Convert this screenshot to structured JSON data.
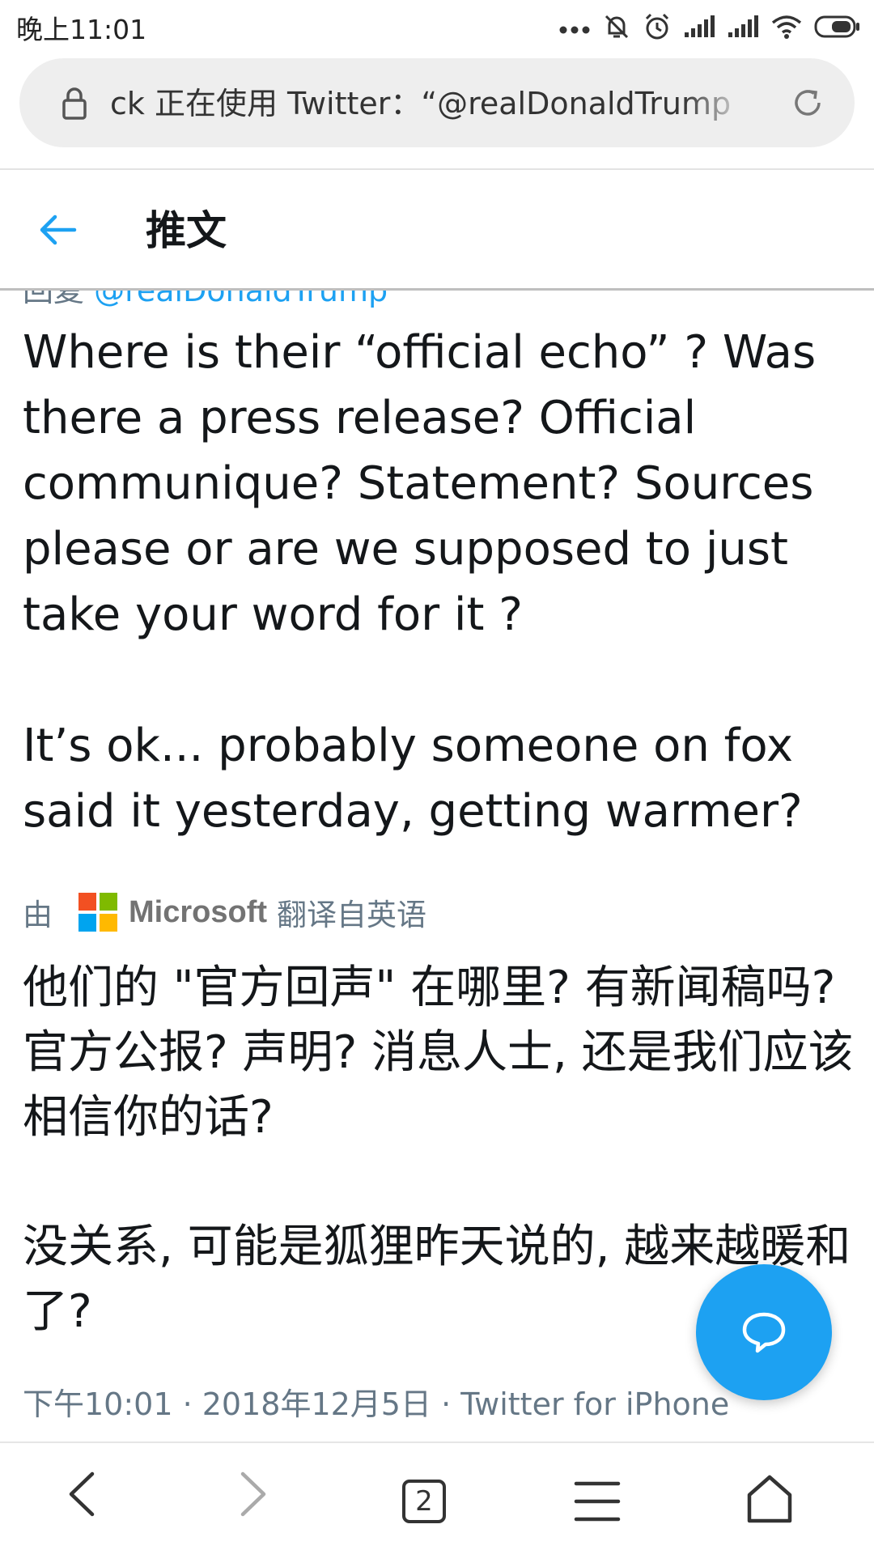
{
  "status_bar": {
    "time": "晚上11:01"
  },
  "browser": {
    "url_text": "ck 正在使用 Twitter：“@realDonaldTrump",
    "tabs_count": "2"
  },
  "header": {
    "title": "推文"
  },
  "tweet": {
    "reply_prefix": "回复 ",
    "reply_handle": "@realDonaldTrump",
    "text": "Where is their “official echo” ? Was there a press release? Official communique? Statement? Sources please or are we supposed to just take your word for it ?\n\nIt’s ok... probably someone on fox said it yesterday, getting warmer?",
    "translation_prefix": "由",
    "translation_provider": "Microsoft",
    "translation_suffix": "翻译自英语",
    "translated_text": "他们的 \"官方回声\" 在哪里? 有新闻稿吗? 官方公报? 声明? 消息人士, 还是我们应该相信你的话?\n\n没关系, 可能是狐狸昨天说的, 越来越暖和了?",
    "meta": "下午10:01 · 2018年12月5日 · Twitter for iPhone"
  },
  "colors": {
    "twitter_blue": "#1da1f2",
    "secondary_text": "#657786",
    "ms_red": "#f25022",
    "ms_green": "#7fba00",
    "ms_blue": "#00a4ef",
    "ms_yellow": "#ffb900"
  },
  "icons": [
    "more-dots-icon",
    "mute-icon",
    "alarm-icon",
    "signal-icon",
    "wifi-icon",
    "battery-icon",
    "lock-icon",
    "reload-icon",
    "back-arrow-icon",
    "microsoft-logo-icon",
    "reply-icon",
    "nav-back-icon",
    "nav-forward-icon",
    "tabs-icon",
    "menu-icon",
    "home-icon"
  ]
}
